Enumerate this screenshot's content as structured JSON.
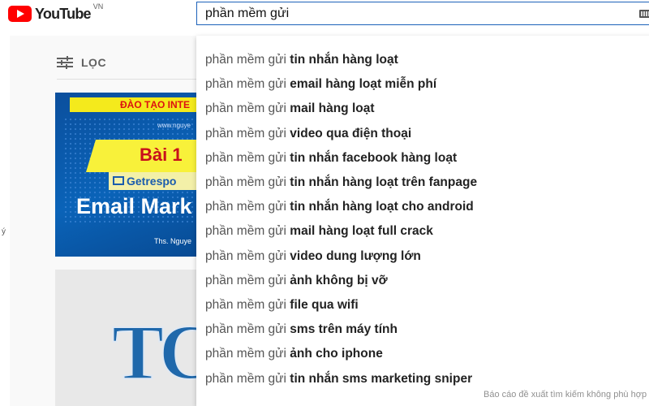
{
  "header": {
    "logo_text": "YouTube",
    "region": "VN"
  },
  "search": {
    "query": "phần mềm gửi"
  },
  "filter": {
    "label": "LỌC"
  },
  "left_edge_char": "ý",
  "thumb1": {
    "banner": "ĐÀO TẠO INTE",
    "url": "www.nguye",
    "bai": "Bài 1",
    "getresponse": "Getrespo",
    "email": "Email Mark",
    "author": "Ths. Nguye"
  },
  "thumb2": {
    "logo_text": "TC"
  },
  "suggestions": [
    {
      "prefix": "phần mềm gửi ",
      "completion": "tin nhắn hàng loạt"
    },
    {
      "prefix": "phần mềm gửi ",
      "completion": "email hàng loạt miễn phí"
    },
    {
      "prefix": "phần mềm gửi ",
      "completion": "mail hàng loạt"
    },
    {
      "prefix": "phần mềm gửi ",
      "completion": "video qua điện thoại"
    },
    {
      "prefix": "phần mềm gửi ",
      "completion": "tin nhắn facebook hàng loạt"
    },
    {
      "prefix": "phần mềm gửi ",
      "completion": "tin nhắn hàng loạt trên fanpage"
    },
    {
      "prefix": "phần mềm gửi ",
      "completion": "tin nhắn hàng loạt cho android"
    },
    {
      "prefix": "phần mềm gửi ",
      "completion": "mail hàng loạt full crack"
    },
    {
      "prefix": "phần mềm gửi ",
      "completion": "video dung lượng lớn"
    },
    {
      "prefix": "phần mềm gửi ",
      "completion": "ảnh không bị vỡ"
    },
    {
      "prefix": "phần mềm gửi ",
      "completion": "file qua wifi"
    },
    {
      "prefix": "phần mềm gửi ",
      "completion": "sms trên máy tính"
    },
    {
      "prefix": "phần mềm gửi ",
      "completion": "ảnh cho iphone"
    },
    {
      "prefix": "phần mềm gửi ",
      "completion": "tin nhắn sms marketing sniper"
    }
  ],
  "report_text": "Báo cáo đề xuất tìm kiếm không phù hợp",
  "colors": {
    "brand_red": "#ff0000",
    "search_border": "#1c62b9"
  }
}
